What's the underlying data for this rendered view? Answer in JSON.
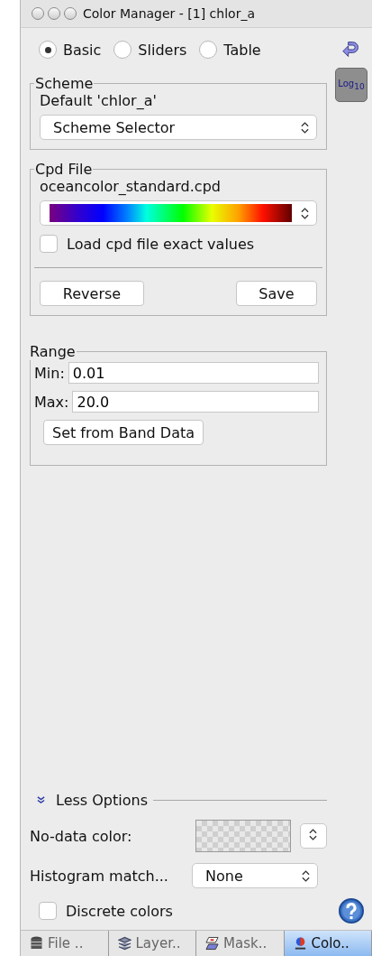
{
  "window": {
    "title": "Color Manager - [1] chlor_a"
  },
  "modes": [
    {
      "label": "Basic",
      "selected": true
    },
    {
      "label": "Sliders",
      "selected": false
    },
    {
      "label": "Table",
      "selected": false
    }
  ],
  "log_button": {
    "text": "Log",
    "subscript": "10"
  },
  "scheme": {
    "title": "Scheme",
    "current": "Default 'chlor_a'",
    "selector": "Scheme Selector"
  },
  "cpd_file": {
    "title": "Cpd File",
    "file": "oceancolor_standard.cpd",
    "load_exact": {
      "label": "Load cpd file exact values",
      "checked": false
    },
    "buttons": [
      "Reverse",
      "Save"
    ]
  },
  "range": {
    "title": "Range",
    "min_label": "Min:",
    "min": "0.01",
    "max_label": "Max:",
    "max": "20.0",
    "button": "Set from Band Data"
  },
  "options": {
    "toggle": "Less Options",
    "no_data_label": "No-data color:",
    "histogram_label": "Histogram match...",
    "histogram_value": "None",
    "discrete": {
      "label": "Discrete colors",
      "checked": false
    }
  },
  "bottom_tabs": [
    {
      "label": "File ..",
      "selected": false
    },
    {
      "label": "Layer..",
      "selected": false
    },
    {
      "label": "Mask..",
      "selected": false
    },
    {
      "label": "Colo..",
      "selected": true
    }
  ]
}
